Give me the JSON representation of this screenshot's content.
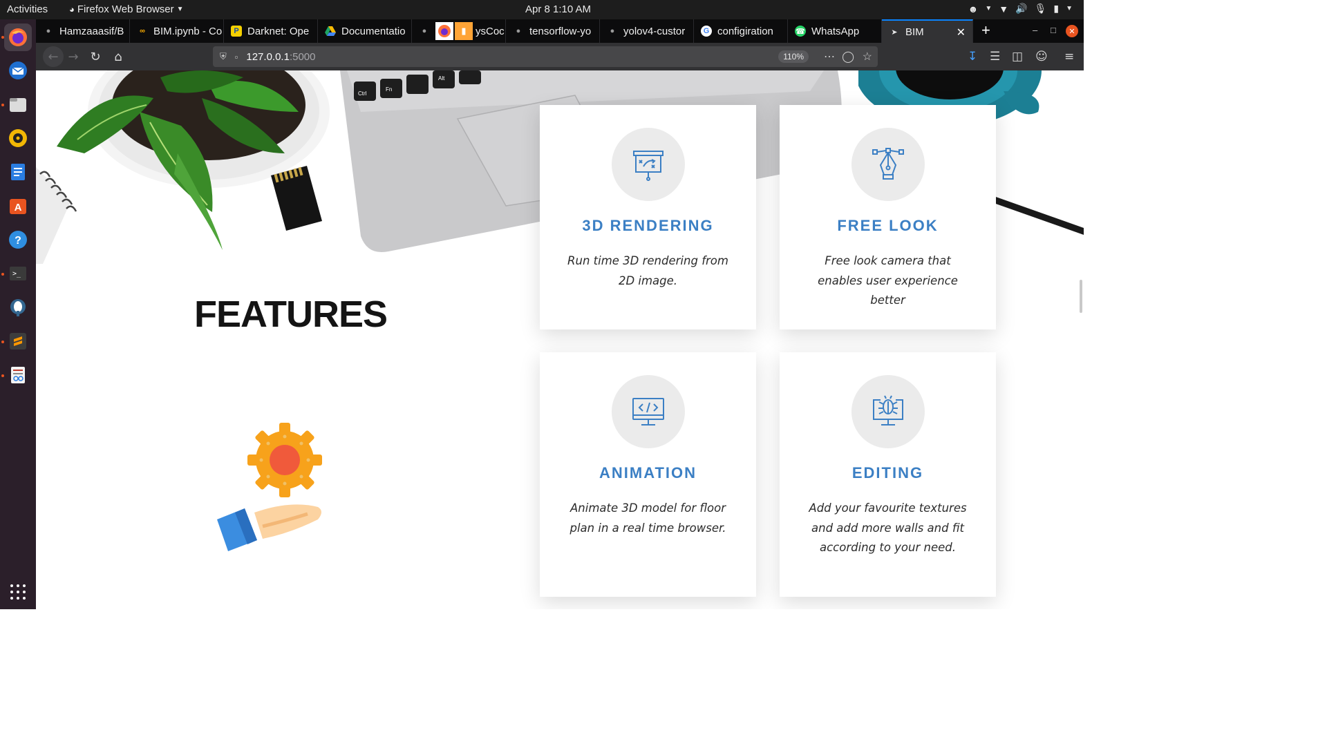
{
  "topbar": {
    "activities": "Activities",
    "app_name": "Firefox Web Browser",
    "clock": "Apr 8  1:10 AM"
  },
  "dock": {
    "items": [
      "firefox-icon",
      "thunderbird-icon",
      "files-icon",
      "rhythmbox-icon",
      "writer-icon",
      "software-icon",
      "help-icon",
      "terminal-icon",
      "postgres-icon",
      "sublime-icon",
      "document-viewer-icon"
    ]
  },
  "tabs": [
    {
      "label": "Hamzaaasif/B",
      "icon": "github-icon"
    },
    {
      "label": "BIM.ipynb - Co",
      "icon": "colab-icon"
    },
    {
      "label": "Darknet: Ope",
      "icon": "pjreddie-icon"
    },
    {
      "label": "Documentatio",
      "icon": "drive-icon"
    },
    {
      "label": "ysCoc",
      "icon": "github-icon"
    },
    {
      "label": "tensorflow-yo",
      "icon": "github-icon"
    },
    {
      "label": "yolov4-custor",
      "icon": "github-icon"
    },
    {
      "label": "configiration",
      "icon": "google-icon"
    },
    {
      "label": "WhatsApp",
      "icon": "whatsapp-icon"
    },
    {
      "label": "BIM",
      "icon": "page-icon"
    }
  ],
  "navbar": {
    "url_host": "127.0.0.1",
    "url_port": ":5000",
    "zoom": "110%"
  },
  "page": {
    "section_title": "FEATURES",
    "cards": [
      {
        "title": "3D RENDERING",
        "description": "Run time 3D rendering from 2D image.",
        "icon": "presentation-board-icon"
      },
      {
        "title": "FREE LOOK",
        "description": "Free look camera that enables user experience better",
        "icon": "vector-pen-icon"
      },
      {
        "title": "ANIMATION",
        "description": "Animate 3D model for floor plan in a real time browser.",
        "icon": "code-monitor-icon"
      },
      {
        "title": "EDITING",
        "description": "Add your favourite textures and add more walls and fit according to your need.",
        "icon": "bug-monitor-icon"
      }
    ]
  },
  "colors": {
    "accent": "#3b7fc4",
    "firefox_blue": "#0a84ff",
    "ubuntu_orange": "#e95420"
  }
}
